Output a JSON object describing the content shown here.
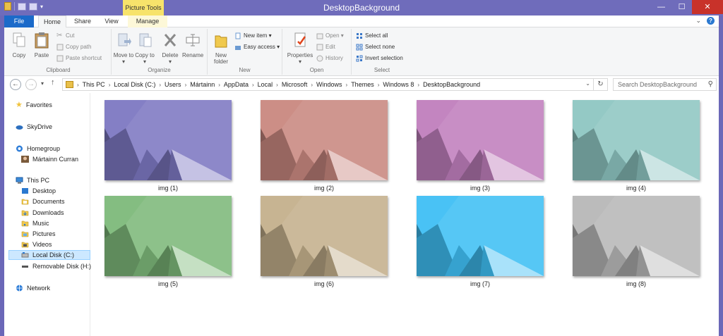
{
  "window": {
    "title": "DesktopBackground",
    "context_tab_group": "Picture Tools",
    "controls": {
      "minimize": "—",
      "maximize": "☐",
      "close": "✕"
    }
  },
  "ribbon_tabs": {
    "file": "File",
    "home": "Home",
    "share": "Share",
    "view": "View",
    "manage": "Manage"
  },
  "ribbon": {
    "clipboard": {
      "label": "Clipboard",
      "copy": "Copy",
      "paste": "Paste",
      "cut": "Cut",
      "copy_path": "Copy path",
      "paste_shortcut": "Paste shortcut"
    },
    "organize": {
      "label": "Organize",
      "move_to": "Move to ▾",
      "copy_to": "Copy to ▾",
      "delete": "Delete",
      "delete_sub": "▾",
      "rename": "Rename"
    },
    "new": {
      "label": "New",
      "new_folder_1": "New",
      "new_folder_2": "folder",
      "new_item": "New item ▾",
      "easy_access": "Easy access ▾"
    },
    "open": {
      "label": "Open",
      "properties": "Properties",
      "properties_sub": "▾",
      "open": "Open ▾",
      "edit": "Edit",
      "history": "History"
    },
    "select": {
      "label": "Select",
      "select_all": "Select all",
      "select_none": "Select none",
      "invert": "Invert selection"
    }
  },
  "address": {
    "crumbs": [
      "This PC",
      "Local Disk (C:)",
      "Users",
      "Mártainn",
      "AppData",
      "Local",
      "Microsoft",
      "Windows",
      "Themes",
      "Windows 8",
      "DesktopBackground"
    ],
    "search_placeholder": "Search DesktopBackground"
  },
  "navpane": {
    "favorites": "Favorites",
    "skydrive": "SkyDrive",
    "homegroup": "Homegroup",
    "user": "Mártainn Curran",
    "this_pc": "This PC",
    "desktop": "Desktop",
    "documents": "Documents",
    "downloads": "Downloads",
    "music": "Music",
    "pictures": "Pictures",
    "videos": "Videos",
    "local_disk": "Local Disk (C:)",
    "removable": "Removable Disk (H:)",
    "network": "Network"
  },
  "files": [
    {
      "name": "img (1)",
      "color": "#7d78c2"
    },
    {
      "name": "img (2)",
      "color": "#c98880"
    },
    {
      "name": "img (3)",
      "color": "#c07fbd"
    },
    {
      "name": "img (4)",
      "color": "#8ec6c2"
    },
    {
      "name": "img (5)",
      "color": "#7eb97a"
    },
    {
      "name": "img (6)",
      "color": "#c4b08c"
    },
    {
      "name": "img (7)",
      "color": "#3fbff4"
    },
    {
      "name": "img (8)",
      "color": "#b7b7b7"
    }
  ],
  "colors": {
    "titlebar": "#6f6cbb",
    "file_tab": "#1b6ac9",
    "context_tab": "#f7e36b",
    "close": "#c8322a",
    "selection": "#cce8ff"
  }
}
